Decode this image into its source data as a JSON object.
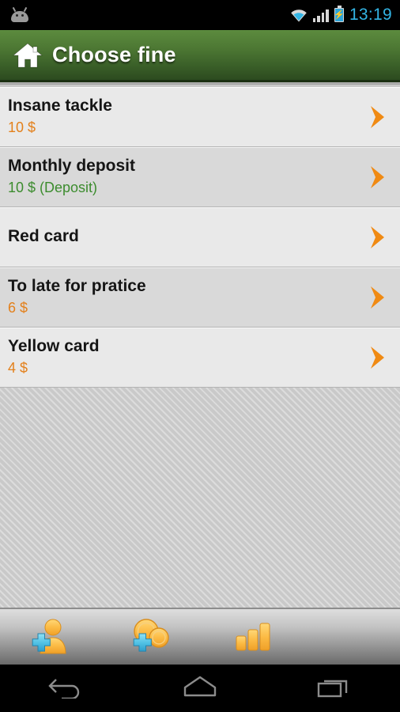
{
  "statusbar": {
    "notification_icon": "android-robot-icon",
    "wifi_icon": "wifi-icon",
    "signal_icon": "cell-signal-icon",
    "battery_icon": "battery-charging-icon",
    "clock": "13:19",
    "clock_color": "#33b5e5"
  },
  "actionbar": {
    "home_icon": "home-icon",
    "title": "Choose fine",
    "color_top": "#5c8b3e",
    "color_bottom": "#2c4a1f"
  },
  "list": {
    "rows": [
      {
        "title": "Insane tackle",
        "subtitle": "10 $",
        "subtitle_kind": "amount",
        "shade": "light",
        "chevron_icon": "chevron-right-icon"
      },
      {
        "title": "Monthly deposit",
        "subtitle": "10 $ (Deposit)",
        "subtitle_kind": "deposit",
        "shade": "dark",
        "chevron_icon": "chevron-right-icon"
      },
      {
        "title": "Red card",
        "subtitle": "",
        "subtitle_kind": "none",
        "shade": "light",
        "chevron_icon": "chevron-right-icon"
      },
      {
        "title": "To late for pratice",
        "subtitle": "6 $",
        "subtitle_kind": "amount",
        "shade": "dark",
        "chevron_icon": "chevron-right-icon"
      },
      {
        "title": "Yellow card",
        "subtitle": "4 $",
        "subtitle_kind": "amount",
        "shade": "light",
        "chevron_icon": "chevron-right-icon"
      }
    ],
    "amount_color": "#e3801b",
    "deposit_color": "#3c8c2e",
    "chevron_color": "#f08a13"
  },
  "toolbar": {
    "buttons": [
      {
        "icon": "add-person-icon",
        "label": "Add player"
      },
      {
        "icon": "add-coins-icon",
        "label": "Add fine"
      },
      {
        "icon": "bar-chart-icon",
        "label": "Statistics"
      }
    ]
  },
  "navbar": {
    "buttons": [
      {
        "icon": "back-icon",
        "label": "Back"
      },
      {
        "icon": "home-icon",
        "label": "Home"
      },
      {
        "icon": "recents-icon",
        "label": "Recents"
      }
    ]
  }
}
